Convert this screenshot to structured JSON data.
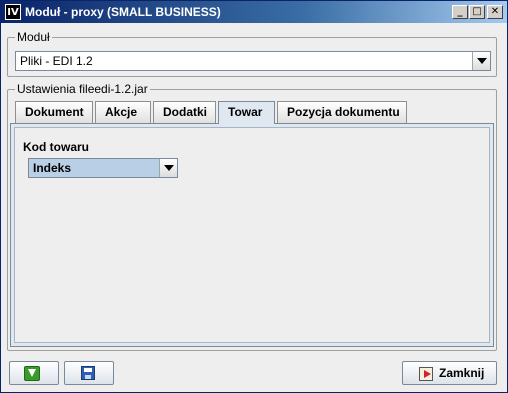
{
  "window": {
    "title": "Moduł - proxy (SMALL BUSINESS)",
    "icon": "IV",
    "minimize_glyph": "_",
    "maximize_glyph": "□",
    "close_glyph": "✕"
  },
  "modul_group": {
    "label": "Moduł",
    "selected": "Pliki - EDI 1.2"
  },
  "settings_group": {
    "label": "Ustawienia fileedi-1.2.jar"
  },
  "tabs": [
    {
      "label": "Dokument",
      "active": false
    },
    {
      "label": "Akcje",
      "active": false
    },
    {
      "label": "Dodatki",
      "active": false
    },
    {
      "label": "Towar",
      "active": true
    },
    {
      "label": "Pozycja dokumentu",
      "active": false
    }
  ],
  "towar_tab": {
    "kod_label": "Kod towaru",
    "kod_selected": "Indeks"
  },
  "footer": {
    "download_icon": "download-icon",
    "save_icon": "save-icon",
    "close_label": "Zamknij",
    "close_icon": "exit-icon"
  }
}
